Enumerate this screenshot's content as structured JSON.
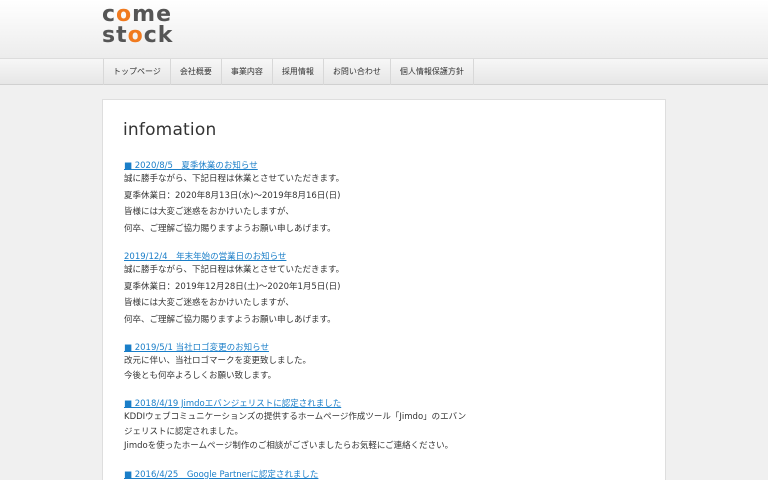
{
  "logo": {
    "line1_a": "c",
    "line1_o": "o",
    "line1_b": "me",
    "line2_a": "st",
    "line2_o": "o",
    "line2_b": "ck"
  },
  "nav": [
    "トップページ",
    "会社概要",
    "事業内容",
    "採用情報",
    "お問い合わせ",
    "個人情報保護方針"
  ],
  "page_title": "infomation",
  "entries": [
    {
      "title": "■ 2020/8/5　夏季休業のお知らせ",
      "lines": [
        "誠に勝手ながら、下記日程は休業とさせていただきます。",
        "夏季休業日：2020年8月13日(水)〜2019年8月16日(日)",
        "皆様には大変ご迷惑をおかけいたしますが、",
        "何卒、ご理解ご協力賜りますようお願い申しあげます。"
      ]
    },
    {
      "title": "2019/12/4　年末年始の営業日のお知らせ",
      "lines": [
        "誠に勝手ながら、下記日程は休業とさせていただきます。",
        "夏季休業日：2019年12月28日(土)〜2020年1月5日(日)",
        "皆様には大変ご迷惑をおかけいたしますが、",
        "何卒、ご理解ご協力賜りますようお願い申しあげます。"
      ]
    },
    {
      "title": "■ 2019/5/1 当社ロゴ変更のお知らせ",
      "lines": [
        "改元に伴い、当社ロゴマークを変更致しました。",
        "今後とも何卒よろしくお願い致します。"
      ]
    },
    {
      "title": "■ 2018/4/19 Jimdoエバンジェリストに認定されました",
      "lines": [
        "KDDIウェブコミュニケーションズの提供するホームページ作成ツール「Jimdo」のエバン",
        "ジェリストに認定されました。",
        "Jimdoを使ったホームページ制作のご相談がございましたらお気軽にご連絡ください。"
      ]
    },
    {
      "title": "■ 2016/4/25　Google Partnerに認定されました",
      "lines": []
    }
  ]
}
